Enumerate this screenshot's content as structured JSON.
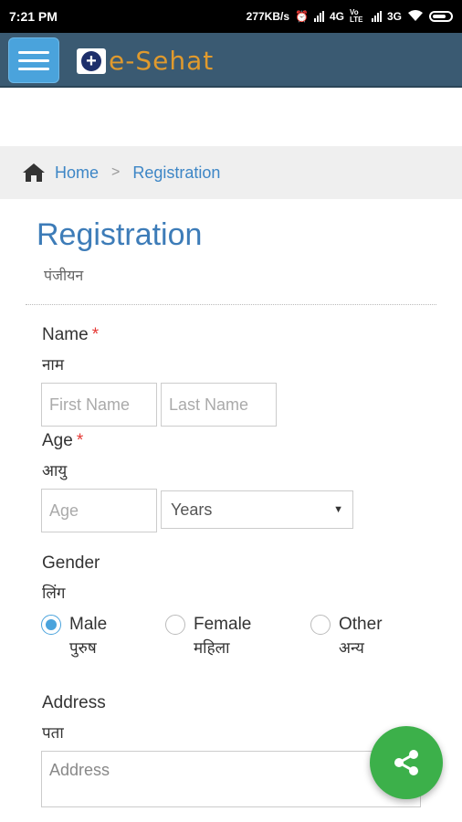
{
  "status_bar": {
    "time": "7:21 PM",
    "speed": "277KB/s",
    "network1": "4G",
    "volte": "Vo LTE",
    "network2": "3G"
  },
  "app_bar": {
    "brand": "e-Sehat"
  },
  "breadcrumb": {
    "home": "Home",
    "separator": ">",
    "current": "Registration"
  },
  "page": {
    "title": "Registration",
    "subtitle_hi": "पंजीयन"
  },
  "form": {
    "name": {
      "label": "Name",
      "required_mark": "*",
      "label_hi": "नाम",
      "first_placeholder": "First Name",
      "last_placeholder": "Last Name"
    },
    "age": {
      "label": "Age",
      "required_mark": "*",
      "label_hi": "आयु",
      "placeholder": "Age",
      "unit_selected": "Years"
    },
    "gender": {
      "label": "Gender",
      "label_hi": "लिंग",
      "options": [
        {
          "label": "Male",
          "label_hi": "पुरुष",
          "checked": true
        },
        {
          "label": "Female",
          "label_hi": "महिला",
          "checked": false
        },
        {
          "label": "Other",
          "label_hi": "अन्य",
          "checked": false
        }
      ]
    },
    "address": {
      "label": "Address",
      "label_hi": "पता",
      "placeholder": "Address"
    }
  },
  "colors": {
    "app_bar": "#3a5a72",
    "accent": "#4aa3dc",
    "link": "#3d86c6",
    "brand_text": "#e09a2d",
    "fab": "#3cb04a",
    "required": "#e53935"
  },
  "icons": {
    "menu": "hamburger-icon",
    "home": "home-icon",
    "share": "share-icon"
  }
}
